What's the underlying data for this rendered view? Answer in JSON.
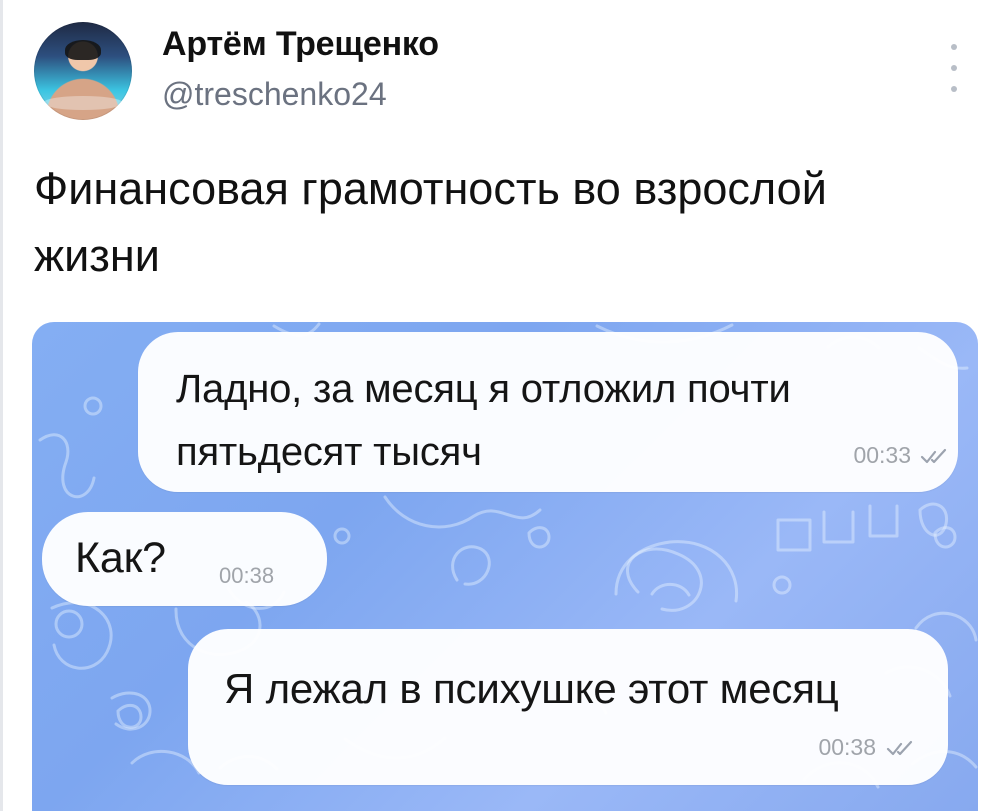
{
  "account": {
    "display_name": "Артём Трещенко",
    "handle": "@treschenko24"
  },
  "post": {
    "text": "Финансовая грамотность во взрослой жизни"
  },
  "chat": {
    "messages": [
      {
        "text": "Ладно, за месяц я отложил почти пятьдесят тысяч",
        "time": "00:33",
        "direction": "outgoing",
        "status_icon": "double-check-icon"
      },
      {
        "text": "Как?",
        "time": "00:38",
        "direction": "incoming"
      },
      {
        "text": "Я лежал в психушке этот месяц",
        "time": "00:38",
        "direction": "outgoing",
        "status_icon": "double-check-icon"
      }
    ],
    "background_color": "#84aef3"
  },
  "icons": {
    "more": "more-vertical-icon"
  }
}
